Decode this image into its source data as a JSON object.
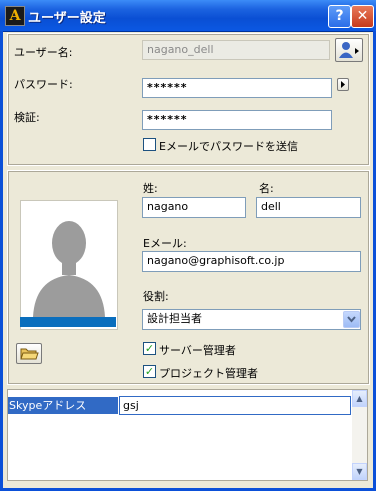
{
  "window": {
    "title": "ユーザー設定",
    "help_label": "?",
    "close_label": "✕",
    "logo_glyph": "A"
  },
  "account": {
    "username_label": "ユーザー名:",
    "username_value": "nagano_dell",
    "password_label": "パスワード:",
    "password_value": "******",
    "verify_label": "検証:",
    "verify_value": "******",
    "email_password_checkbox": {
      "label": "Eメールでパスワードを送信",
      "checked": false
    }
  },
  "profile": {
    "last_name_label": "姓:",
    "last_name_value": "nagano",
    "first_name_label": "名:",
    "first_name_value": "dell",
    "email_label": "Eメール:",
    "email_value": "nagano@graphisoft.co.jp",
    "role_label": "役割:",
    "role_value": "設計担当者",
    "server_admin": {
      "label": "サーバー管理者",
      "checked": true
    },
    "project_admin": {
      "label": "プロジェクト管理者",
      "checked": true
    }
  },
  "contacts": {
    "rows": [
      {
        "key": "Skypeアドレス",
        "value": "gsj"
      }
    ]
  },
  "icons": [
    "user-icon",
    "play-arrow-icon",
    "folder-icon",
    "dropdown-arrow-icon",
    "scroll-up-icon",
    "scroll-down-icon"
  ],
  "colors": {
    "titlebar": "#0a4fd4",
    "selection": "#316ac5",
    "dialog_bg": "#ece9d8",
    "photo_bar": "#0a6ebd"
  }
}
